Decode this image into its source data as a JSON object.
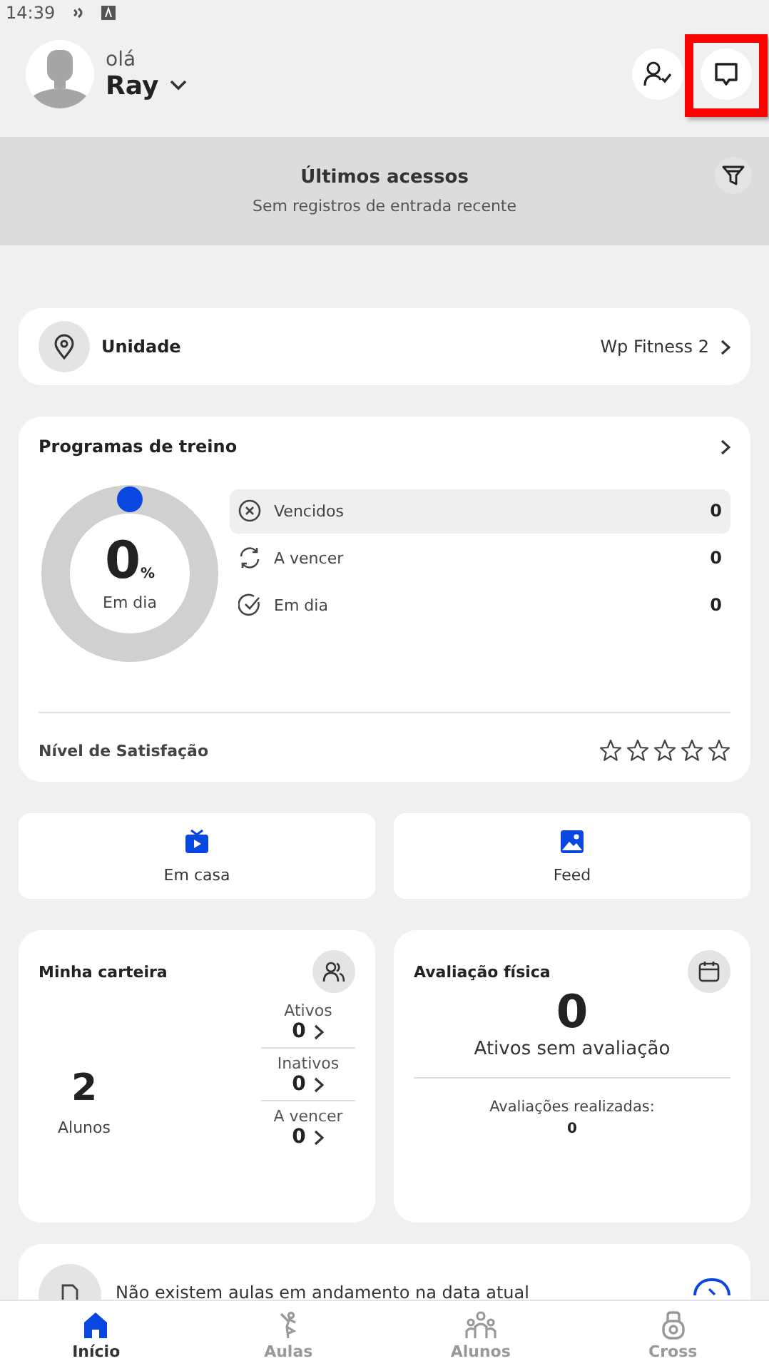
{
  "status_bar": {
    "time": "14:39"
  },
  "header": {
    "greeting": "olá",
    "user_name": "Ray",
    "chat_highlighted": true
  },
  "recent_access": {
    "title": "Últimos acessos",
    "message": "Sem registros de entrada recente"
  },
  "unit": {
    "label": "Unidade",
    "value": "Wp Fitness 2"
  },
  "training_programs": {
    "title": "Programas de treino",
    "percent": "0",
    "percent_sign": "%",
    "percent_label": "Em dia",
    "statuses": [
      {
        "kind": "expired",
        "label": "Vencidos",
        "count": "0",
        "selected": true
      },
      {
        "kind": "expiring",
        "label": "A vencer",
        "count": "0",
        "selected": false
      },
      {
        "kind": "ok",
        "label": "Em dia",
        "count": "0",
        "selected": false
      }
    ],
    "satisfaction_label": "Nível de Satisfação",
    "stars": 0
  },
  "shortcuts": [
    {
      "kind": "tv",
      "label": "Em casa"
    },
    {
      "kind": "image",
      "label": "Feed"
    }
  ],
  "wallet": {
    "title": "Minha carteira",
    "total": "2",
    "total_label": "Alunos",
    "groups": [
      {
        "label": "Ativos",
        "count": "0"
      },
      {
        "label": "Inativos",
        "count": "0"
      },
      {
        "label": "A vencer",
        "count": "0"
      }
    ]
  },
  "assessment": {
    "title": "Avaliação física",
    "count": "0",
    "count_label": "Ativos sem avaliação",
    "done_label": "Avaliações realizadas:",
    "done_count": "0"
  },
  "classes": {
    "message": "Não existem aulas em andamento na data atual"
  },
  "bottom_nav": [
    {
      "kind": "home",
      "label": "Início",
      "selected": true
    },
    {
      "kind": "classes",
      "label": "Aulas",
      "selected": false
    },
    {
      "kind": "students",
      "label": "Alunos",
      "selected": false
    },
    {
      "kind": "cross",
      "label": "Cross",
      "selected": false
    }
  ]
}
